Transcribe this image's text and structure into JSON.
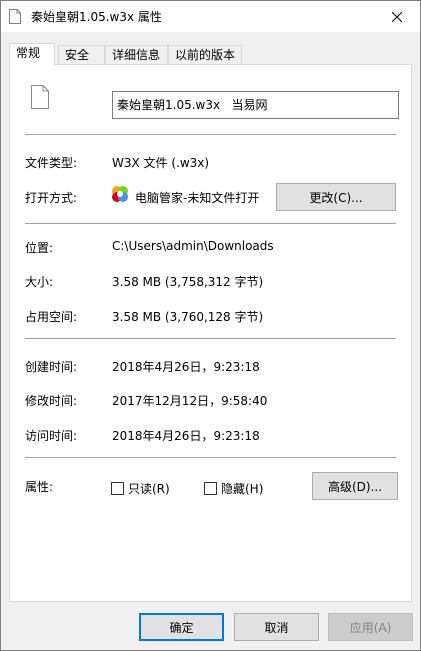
{
  "window": {
    "title": "秦始皇朝1.05.w3x 属性"
  },
  "tabs": [
    {
      "label": "常规",
      "active": true
    },
    {
      "label": "安全",
      "active": false
    },
    {
      "label": "详细信息",
      "active": false
    },
    {
      "label": "以前的版本",
      "active": false
    }
  ],
  "general": {
    "file_name": "秦始皇朝1.05.w3x   当易网",
    "file_type_label": "文件类型:",
    "file_type_value": "W3X 文件 (.w3x)",
    "open_with_label": "打开方式:",
    "open_with_value": "电脑管家-未知文件打开",
    "change_button": "更改(C)...",
    "location_label": "位置:",
    "location_value": "C:\\Users\\admin\\Downloads",
    "size_label": "大小:",
    "size_value": "3.58 MB (3,758,312 字节)",
    "size_on_disk_label": "占用空间:",
    "size_on_disk_value": "3.58 MB (3,760,128 字节)",
    "created_label": "创建时间:",
    "created_value": "2018年4月26日，9:23:18",
    "modified_label": "修改时间:",
    "modified_value": "2017年12月12日，9:58:40",
    "accessed_label": "访问时间:",
    "accessed_value": "2018年4月26日，9:23:18",
    "attributes_label": "属性:",
    "readonly_label": "只读(R)",
    "readonly_checked": false,
    "hidden_label": "隐藏(H)",
    "hidden_checked": false,
    "advanced_button": "高级(D)..."
  },
  "footer": {
    "ok": "确定",
    "cancel": "取消",
    "apply": "应用(A)"
  },
  "colors": {
    "accent": "#0078d7",
    "panel_bg": "#ffffff",
    "window_bg": "#f0f0f0"
  }
}
